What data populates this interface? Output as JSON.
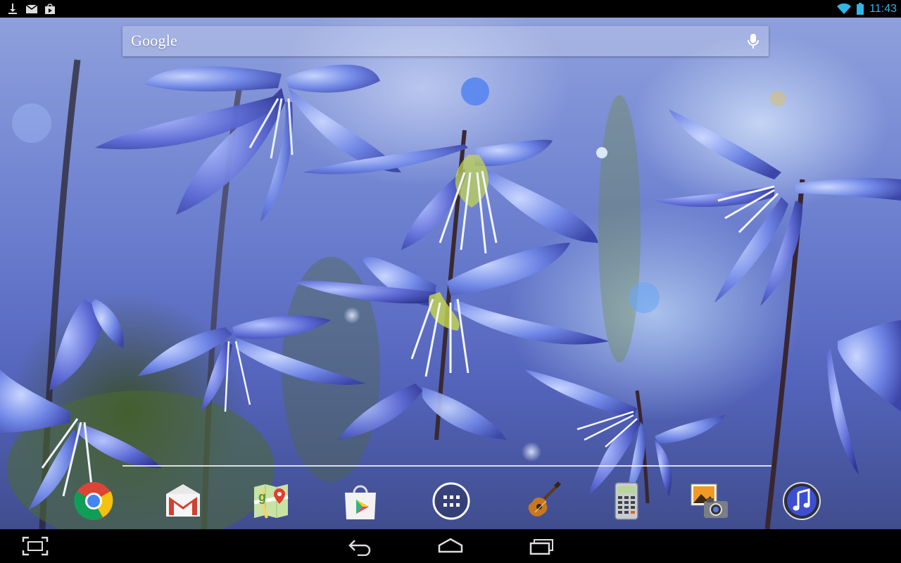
{
  "status_bar": {
    "time": "11:43",
    "notifications": [
      "download-icon",
      "gmail-notification-icon",
      "play-store-update-icon"
    ],
    "indicators": [
      "wifi-icon",
      "battery-icon"
    ],
    "accent_color": "#33b5e5"
  },
  "search": {
    "logo_text": "Google",
    "voice_icon": "mic-icon"
  },
  "dock": {
    "items": [
      {
        "name": "chrome",
        "icon": "chrome-icon"
      },
      {
        "name": "gmail",
        "icon": "gmail-icon"
      },
      {
        "name": "maps",
        "icon": "maps-icon"
      },
      {
        "name": "play-store",
        "icon": "play-store-icon"
      },
      {
        "name": "all-apps",
        "icon": "all-apps-icon"
      },
      {
        "name": "guitar",
        "icon": "guitar-icon"
      },
      {
        "name": "calculator",
        "icon": "calculator-icon"
      },
      {
        "name": "gallery",
        "icon": "gallery-icon"
      },
      {
        "name": "music",
        "icon": "music-icon"
      }
    ]
  },
  "nav_bar": {
    "buttons": [
      "screenshot-icon",
      "back-icon",
      "home-icon",
      "recents-icon"
    ]
  }
}
